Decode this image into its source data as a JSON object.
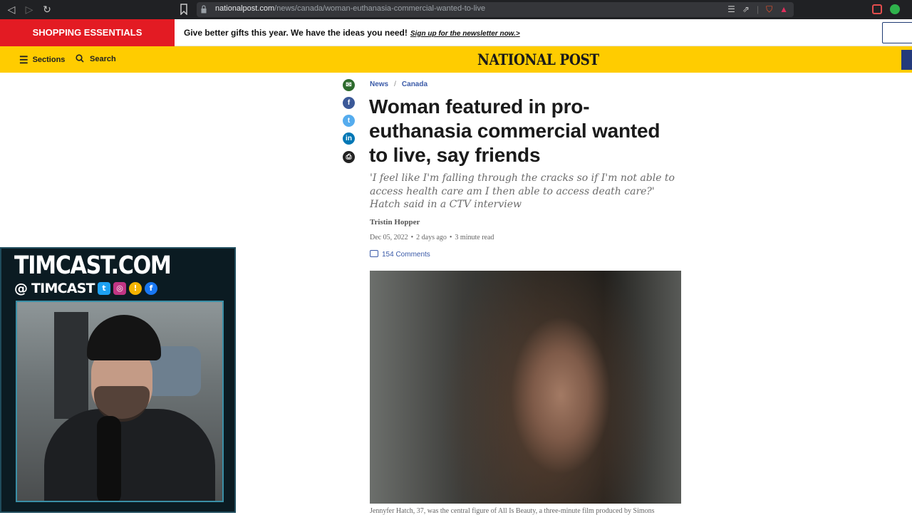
{
  "browser": {
    "back_icon": "back-arrow-icon",
    "forward_icon": "forward-arrow-icon",
    "reload_icon": "reload-icon",
    "url_domain": "nationalpost.com",
    "url_path": "/news/canada/woman-euthanasia-commercial-wanted-to-live"
  },
  "promo": {
    "label": "SHOPPING ESSENTIALS",
    "text": "Give better gifts this year. We have the ideas you need!",
    "link": "Sign up for the newsletter now.>"
  },
  "masthead": {
    "sections": "Sections",
    "search": "Search",
    "logo": "NATIONAL POST"
  },
  "article": {
    "breadcrumb": [
      "News",
      "Canada"
    ],
    "headline": "Woman featured in pro-euthanasia commercial wanted to live, say friends",
    "dek": "'I feel like I'm falling through the cracks so if I'm not able to access health care am I then able to access death care?' Hatch said in a CTV interview",
    "author": "Tristin Hopper",
    "date": "Dec 05, 2022",
    "age": "2 days ago",
    "read_time": "3 minute read",
    "comments": "154 Comments",
    "caption": "Jennyfer Hatch, 37, was the central figure of All Is Beauty, a three-minute film produced by Simons"
  },
  "overlay": {
    "brand": "TIMCAST.COM",
    "handle": "@ TIMCAST"
  },
  "colors": {
    "masthead": "#ffcc00",
    "promo_red": "#e31b23",
    "link_blue": "#3a5aa8"
  }
}
